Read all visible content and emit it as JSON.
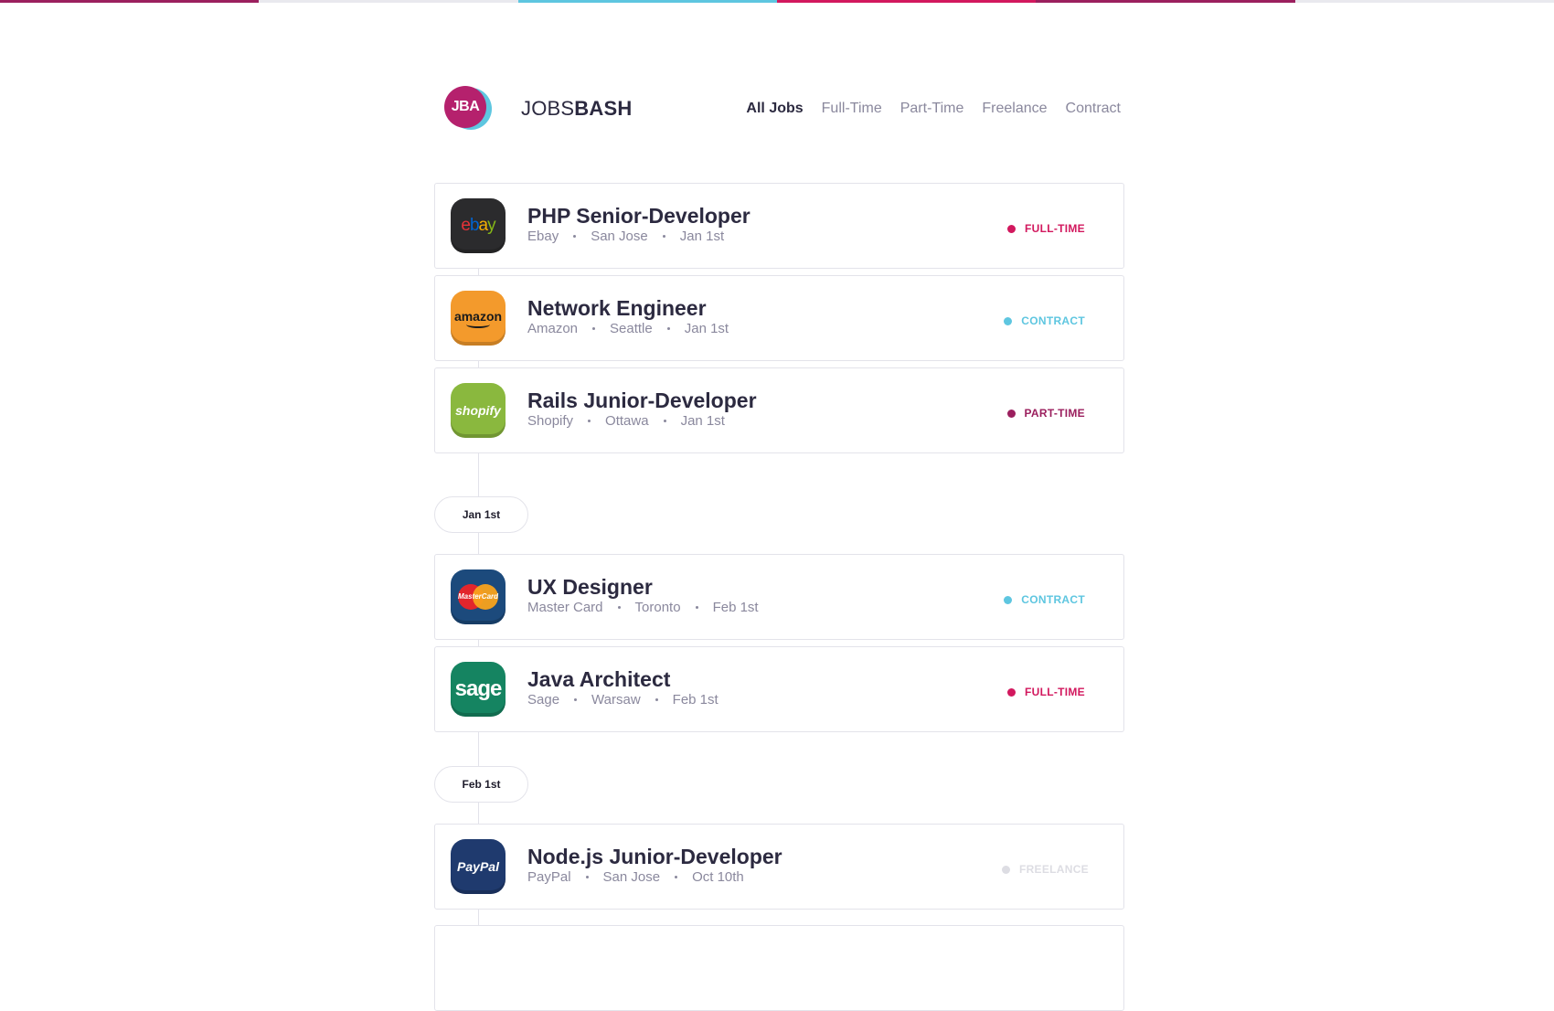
{
  "colors": {
    "topbar": [
      "#9b1f5e",
      "#e9e9ee",
      "#5ec6e0",
      "#d2185e",
      "#9b1f5e",
      "#e9e9ee"
    ],
    "full_time": "#d2185e",
    "contract": "#5ec6e0",
    "part_time": "#9b1f5e",
    "freelance": "#dddde3"
  },
  "header": {
    "logo_text": "JBA",
    "brand_light": "JOBS",
    "brand_bold": "BASH",
    "nav": [
      "All Jobs",
      "Full-Time",
      "Part-Time",
      "Freelance",
      "Contract"
    ],
    "active_nav": "All Jobs"
  },
  "jobs": [
    {
      "title": "PHP Senior-Developer",
      "company": "Ebay",
      "location": "San Jose",
      "date": "Jan 1st",
      "type": "FULL-TIME",
      "icon": "ebay-logo-icon",
      "icon_text": "ebay"
    },
    {
      "title": "Network Engineer",
      "company": "Amazon",
      "location": "Seattle",
      "date": "Jan 1st",
      "type": "CONTRACT",
      "icon": "amazon-logo-icon",
      "icon_text": "amazon"
    },
    {
      "title": "Rails Junior-Developer",
      "company": "Shopify",
      "location": "Ottawa",
      "date": "Jan 1st",
      "type": "PART-TIME",
      "icon": "shopify-logo-icon",
      "icon_text": "shopify"
    },
    {
      "title": "UX Designer",
      "company": "Master Card",
      "location": "Toronto",
      "date": "Feb 1st",
      "type": "CONTRACT",
      "icon": "mastercard-logo-icon",
      "icon_text": "MasterCard"
    },
    {
      "title": "Java Architect",
      "company": "Sage",
      "location": "Warsaw",
      "date": "Feb 1st",
      "type": "FULL-TIME",
      "icon": "sage-logo-icon",
      "icon_text": "sage"
    },
    {
      "title": "Node.js Junior-Developer",
      "company": "PayPal",
      "location": "San Jose",
      "date": "Oct 10th",
      "type": "FREELANCE",
      "icon": "paypal-logo-icon",
      "icon_text": "PayPal"
    }
  ],
  "date_separators": [
    "Jan 1st",
    "Feb 1st"
  ]
}
